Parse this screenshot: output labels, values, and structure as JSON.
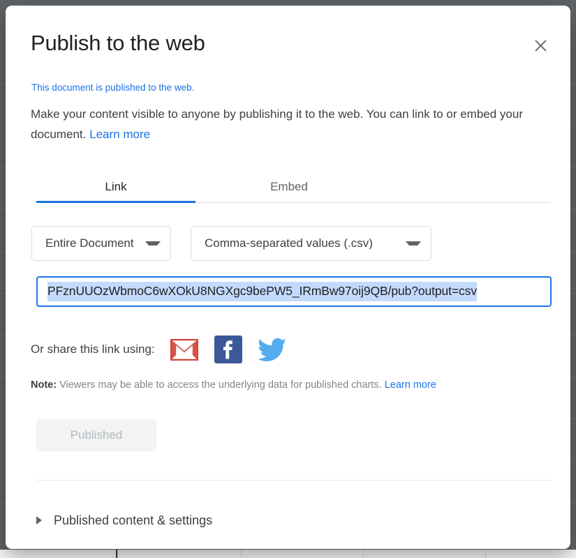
{
  "dialog": {
    "title": "Publish to the web",
    "close_icon": "close-icon",
    "status_link": "This document is published to the web.",
    "description_text": "Make your content visible to anyone by publishing it to the web. You can link to or embed your document.",
    "description_link": "Learn more"
  },
  "tabs": [
    {
      "label": "Link",
      "active": true
    },
    {
      "label": "Embed",
      "active": false
    }
  ],
  "selects": {
    "scope": {
      "value": "Entire Document",
      "caret_icon": "chevron-down-icon"
    },
    "format": {
      "value": "Comma-separated values (.csv)",
      "caret_icon": "chevron-down-icon"
    }
  },
  "url_field": {
    "value": "PFznUUOzWbmoC6wXOkU8NGXgc9bePW5_IRmBw97oij9QB/pub?output=csv",
    "selected": true,
    "border_color": "#1a73e8",
    "selection_color": "#c4dafc"
  },
  "share": {
    "label": "Or share this link using:",
    "icons": [
      {
        "name": "gmail-icon",
        "label": "Gmail",
        "color": "#d44638"
      },
      {
        "name": "facebook-icon",
        "label": "Facebook",
        "color": "#3b5998"
      },
      {
        "name": "twitter-icon",
        "label": "Twitter",
        "color": "#55acee"
      }
    ]
  },
  "note": {
    "prefix": "Note:",
    "text": "Viewers may be able to access the underlying data for published charts.",
    "link": "Learn more"
  },
  "publish_button": {
    "label": "Published",
    "disabled": true
  },
  "disclosure": {
    "label": "Published content & settings",
    "expanded": false,
    "arrow_icon": "triangle-right-icon"
  },
  "theme": {
    "accent": "#1a73e8",
    "text_primary": "#202124",
    "text_secondary": "#3c4043",
    "text_muted": "#80868b",
    "backdrop": "#5f6368"
  }
}
